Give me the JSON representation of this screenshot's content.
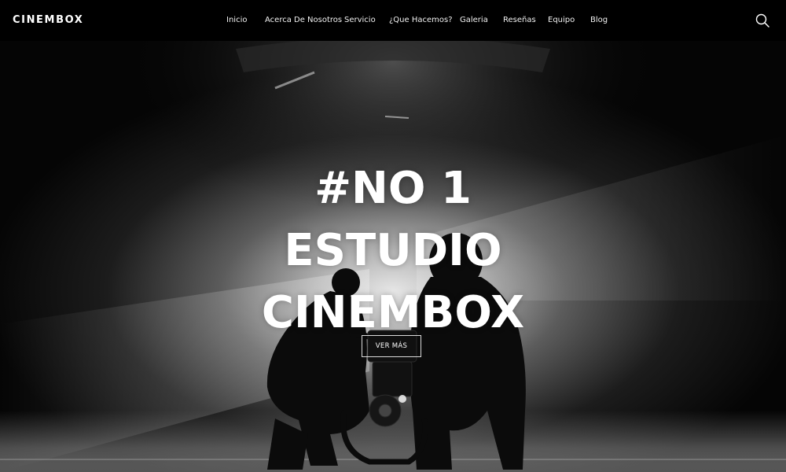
{
  "brand": {
    "name": "CINEMBOX"
  },
  "nav": {
    "items": [
      {
        "label": "Inicio"
      },
      {
        "label": "Acerca De Nosotros"
      },
      {
        "label": "Servicio"
      },
      {
        "label": "¿Que Hacemos?"
      },
      {
        "label": "Galeria"
      },
      {
        "label": "Reseñas"
      },
      {
        "label": "Equipo"
      },
      {
        "label": "Blog"
      }
    ],
    "search_icon": "search-icon"
  },
  "hero": {
    "title_lines": [
      "#NO 1",
      "ESTUDIO",
      "CINEMBOX"
    ],
    "cta_label": "VER MÁS"
  },
  "colors": {
    "navbar_bg": "#000000",
    "text": "#ffffff"
  }
}
